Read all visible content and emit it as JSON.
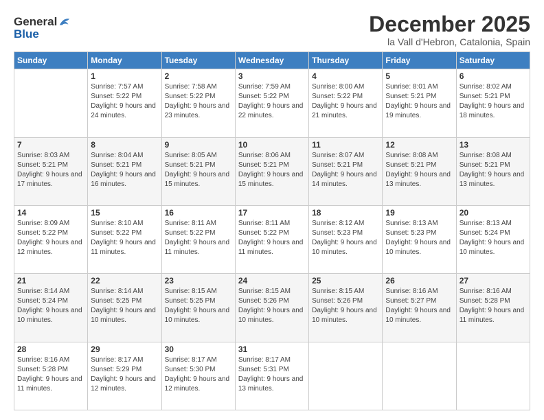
{
  "header": {
    "logo_line1": "General",
    "logo_line2": "Blue",
    "month": "December 2025",
    "location": "la Vall d'Hebron, Catalonia, Spain"
  },
  "days_of_week": [
    "Sunday",
    "Monday",
    "Tuesday",
    "Wednesday",
    "Thursday",
    "Friday",
    "Saturday"
  ],
  "weeks": [
    [
      {
        "day": "",
        "sunrise": "",
        "sunset": "",
        "daylight": ""
      },
      {
        "day": "1",
        "sunrise": "Sunrise: 7:57 AM",
        "sunset": "Sunset: 5:22 PM",
        "daylight": "Daylight: 9 hours and 24 minutes."
      },
      {
        "day": "2",
        "sunrise": "Sunrise: 7:58 AM",
        "sunset": "Sunset: 5:22 PM",
        "daylight": "Daylight: 9 hours and 23 minutes."
      },
      {
        "day": "3",
        "sunrise": "Sunrise: 7:59 AM",
        "sunset": "Sunset: 5:22 PM",
        "daylight": "Daylight: 9 hours and 22 minutes."
      },
      {
        "day": "4",
        "sunrise": "Sunrise: 8:00 AM",
        "sunset": "Sunset: 5:22 PM",
        "daylight": "Daylight: 9 hours and 21 minutes."
      },
      {
        "day": "5",
        "sunrise": "Sunrise: 8:01 AM",
        "sunset": "Sunset: 5:21 PM",
        "daylight": "Daylight: 9 hours and 19 minutes."
      },
      {
        "day": "6",
        "sunrise": "Sunrise: 8:02 AM",
        "sunset": "Sunset: 5:21 PM",
        "daylight": "Daylight: 9 hours and 18 minutes."
      }
    ],
    [
      {
        "day": "7",
        "sunrise": "Sunrise: 8:03 AM",
        "sunset": "Sunset: 5:21 PM",
        "daylight": "Daylight: 9 hours and 17 minutes."
      },
      {
        "day": "8",
        "sunrise": "Sunrise: 8:04 AM",
        "sunset": "Sunset: 5:21 PM",
        "daylight": "Daylight: 9 hours and 16 minutes."
      },
      {
        "day": "9",
        "sunrise": "Sunrise: 8:05 AM",
        "sunset": "Sunset: 5:21 PM",
        "daylight": "Daylight: 9 hours and 15 minutes."
      },
      {
        "day": "10",
        "sunrise": "Sunrise: 8:06 AM",
        "sunset": "Sunset: 5:21 PM",
        "daylight": "Daylight: 9 hours and 15 minutes."
      },
      {
        "day": "11",
        "sunrise": "Sunrise: 8:07 AM",
        "sunset": "Sunset: 5:21 PM",
        "daylight": "Daylight: 9 hours and 14 minutes."
      },
      {
        "day": "12",
        "sunrise": "Sunrise: 8:08 AM",
        "sunset": "Sunset: 5:21 PM",
        "daylight": "Daylight: 9 hours and 13 minutes."
      },
      {
        "day": "13",
        "sunrise": "Sunrise: 8:08 AM",
        "sunset": "Sunset: 5:21 PM",
        "daylight": "Daylight: 9 hours and 13 minutes."
      }
    ],
    [
      {
        "day": "14",
        "sunrise": "Sunrise: 8:09 AM",
        "sunset": "Sunset: 5:22 PM",
        "daylight": "Daylight: 9 hours and 12 minutes."
      },
      {
        "day": "15",
        "sunrise": "Sunrise: 8:10 AM",
        "sunset": "Sunset: 5:22 PM",
        "daylight": "Daylight: 9 hours and 11 minutes."
      },
      {
        "day": "16",
        "sunrise": "Sunrise: 8:11 AM",
        "sunset": "Sunset: 5:22 PM",
        "daylight": "Daylight: 9 hours and 11 minutes."
      },
      {
        "day": "17",
        "sunrise": "Sunrise: 8:11 AM",
        "sunset": "Sunset: 5:22 PM",
        "daylight": "Daylight: 9 hours and 11 minutes."
      },
      {
        "day": "18",
        "sunrise": "Sunrise: 8:12 AM",
        "sunset": "Sunset: 5:23 PM",
        "daylight": "Daylight: 9 hours and 10 minutes."
      },
      {
        "day": "19",
        "sunrise": "Sunrise: 8:13 AM",
        "sunset": "Sunset: 5:23 PM",
        "daylight": "Daylight: 9 hours and 10 minutes."
      },
      {
        "day": "20",
        "sunrise": "Sunrise: 8:13 AM",
        "sunset": "Sunset: 5:24 PM",
        "daylight": "Daylight: 9 hours and 10 minutes."
      }
    ],
    [
      {
        "day": "21",
        "sunrise": "Sunrise: 8:14 AM",
        "sunset": "Sunset: 5:24 PM",
        "daylight": "Daylight: 9 hours and 10 minutes."
      },
      {
        "day": "22",
        "sunrise": "Sunrise: 8:14 AM",
        "sunset": "Sunset: 5:25 PM",
        "daylight": "Daylight: 9 hours and 10 minutes."
      },
      {
        "day": "23",
        "sunrise": "Sunrise: 8:15 AM",
        "sunset": "Sunset: 5:25 PM",
        "daylight": "Daylight: 9 hours and 10 minutes."
      },
      {
        "day": "24",
        "sunrise": "Sunrise: 8:15 AM",
        "sunset": "Sunset: 5:26 PM",
        "daylight": "Daylight: 9 hours and 10 minutes."
      },
      {
        "day": "25",
        "sunrise": "Sunrise: 8:15 AM",
        "sunset": "Sunset: 5:26 PM",
        "daylight": "Daylight: 9 hours and 10 minutes."
      },
      {
        "day": "26",
        "sunrise": "Sunrise: 8:16 AM",
        "sunset": "Sunset: 5:27 PM",
        "daylight": "Daylight: 9 hours and 10 minutes."
      },
      {
        "day": "27",
        "sunrise": "Sunrise: 8:16 AM",
        "sunset": "Sunset: 5:28 PM",
        "daylight": "Daylight: 9 hours and 11 minutes."
      }
    ],
    [
      {
        "day": "28",
        "sunrise": "Sunrise: 8:16 AM",
        "sunset": "Sunset: 5:28 PM",
        "daylight": "Daylight: 9 hours and 11 minutes."
      },
      {
        "day": "29",
        "sunrise": "Sunrise: 8:17 AM",
        "sunset": "Sunset: 5:29 PM",
        "daylight": "Daylight: 9 hours and 12 minutes."
      },
      {
        "day": "30",
        "sunrise": "Sunrise: 8:17 AM",
        "sunset": "Sunset: 5:30 PM",
        "daylight": "Daylight: 9 hours and 12 minutes."
      },
      {
        "day": "31",
        "sunrise": "Sunrise: 8:17 AM",
        "sunset": "Sunset: 5:31 PM",
        "daylight": "Daylight: 9 hours and 13 minutes."
      },
      {
        "day": "",
        "sunrise": "",
        "sunset": "",
        "daylight": ""
      },
      {
        "day": "",
        "sunrise": "",
        "sunset": "",
        "daylight": ""
      },
      {
        "day": "",
        "sunrise": "",
        "sunset": "",
        "daylight": ""
      }
    ]
  ]
}
